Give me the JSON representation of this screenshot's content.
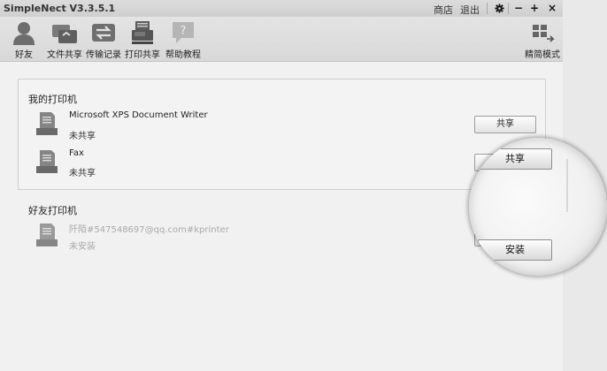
{
  "window": {
    "title": "SimpleNect V3.3.5.1",
    "links": {
      "shop": "商店",
      "logout": "退出"
    },
    "controls": {
      "settings": "gear-icon",
      "minimize": "−",
      "maximize": "+",
      "close": "×"
    }
  },
  "toolbar": {
    "items": [
      {
        "label": "好友",
        "icon": "person-icon"
      },
      {
        "label": "文件共享",
        "icon": "folders-icon"
      },
      {
        "label": "传输记录",
        "icon": "transfer-icon"
      },
      {
        "label": "打印共享",
        "icon": "printer-icon"
      },
      {
        "label": "帮助教程",
        "icon": "help-bubble-icon"
      }
    ],
    "mode": {
      "label": "精简模式",
      "icon": "compact-mode-icon"
    }
  },
  "my_printers": {
    "title": "我的打印机",
    "items": [
      {
        "name": "Microsoft XPS Document Writer",
        "status": "未共享",
        "button": "共享"
      },
      {
        "name": "Fax",
        "status": "未共享",
        "button": "共享"
      }
    ]
  },
  "friend_printers": {
    "title": "好友打印机",
    "items": [
      {
        "name": "阡陌#547548697@qq.com#kprinter",
        "status": "未安装",
        "button": "安装"
      }
    ]
  },
  "magnifier": {
    "share_label": "共享",
    "install_label": "安装"
  }
}
